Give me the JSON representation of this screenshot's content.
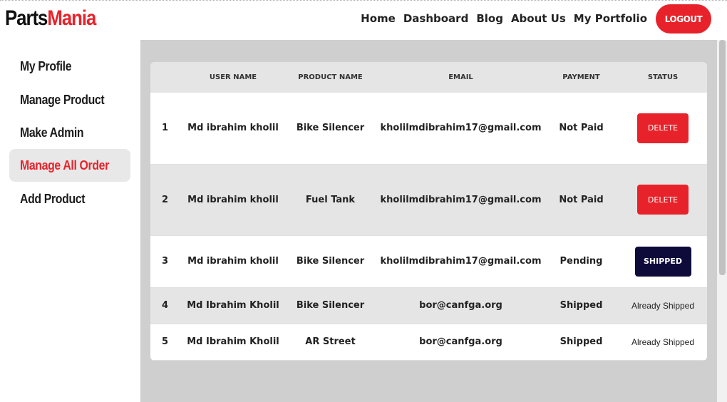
{
  "brand": {
    "part1": "Parts",
    "part2": "Mania"
  },
  "nav": {
    "items": [
      "Home",
      "Dashboard",
      "Blog",
      "About Us",
      "My Portfolio"
    ],
    "logout_label": "LOGOUT"
  },
  "sidebar": {
    "items": [
      {
        "label": "My Profile"
      },
      {
        "label": "Manage Product"
      },
      {
        "label": "Make Admin"
      },
      {
        "label": "Manage All Order",
        "active": true
      },
      {
        "label": "Add Product"
      }
    ]
  },
  "table": {
    "headers": [
      "",
      "USER NAME",
      "PRODUCT NAME",
      "EMAIL",
      "PAYMENT",
      "STATUS"
    ],
    "rows": [
      {
        "num": "1",
        "user": "Md ibrahim kholil",
        "product": "Bike Silencer",
        "email": "kholilmdibrahim17@gmail.com",
        "payment": "Not Paid",
        "status": "DELETE"
      },
      {
        "num": "2",
        "user": "Md ibrahim kholil",
        "product": "Fuel Tank",
        "email": "kholilmdibrahim17@gmail.com",
        "payment": "Not Paid",
        "status": "DELETE"
      },
      {
        "num": "3",
        "user": "Md ibrahim kholil",
        "product": "Bike Silencer",
        "email": "kholilmdibrahim17@gmail.com",
        "payment": "Pending",
        "status": "SHIPPED"
      },
      {
        "num": "4",
        "user": "Md Ibrahim Kholil",
        "product": "Bike Silencer",
        "email": "bor@canfga.org",
        "payment": "Shipped",
        "status": "Already Shipped"
      },
      {
        "num": "5",
        "user": "Md Ibrahim Kholil",
        "product": "AR Street",
        "email": "bor@canfga.org",
        "payment": "Shipped",
        "status": "Already Shipped"
      }
    ]
  },
  "colors": {
    "accent_red": "#e8222a",
    "shipped_navy": "#0e0a3a",
    "content_bg": "#cfcfcf",
    "row_alt": "#e5e5e5"
  }
}
